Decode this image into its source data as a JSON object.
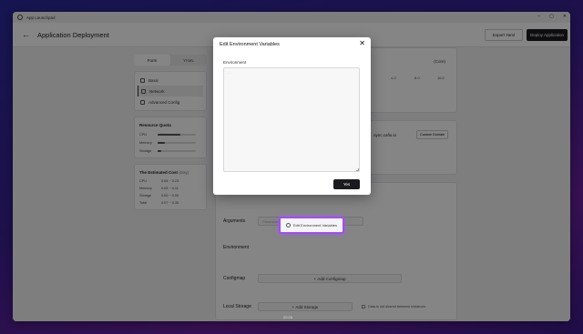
{
  "window": {
    "title": "App Launchpad",
    "controls": [
      "–",
      "▢",
      "✕"
    ]
  },
  "header": {
    "back_icon": "←",
    "title": "Application Deployment",
    "export_label": "Export Yaml",
    "deploy_label": "Deploy Application"
  },
  "sidebar": {
    "tabs": [
      "Form",
      "YAML"
    ],
    "nav": [
      {
        "label": "Basic"
      },
      {
        "label": "Network"
      },
      {
        "label": "Advanced Config"
      }
    ],
    "quota": {
      "title": "Resource Quota",
      "rows": [
        {
          "label": "CPU",
          "fill": 0.6
        },
        {
          "label": "Memory",
          "fill": 0.2
        },
        {
          "label": "Storage",
          "fill": 0.1
        }
      ]
    },
    "cost": {
      "title": "The Estimated Cost",
      "unit": "(Day)",
      "rows": [
        {
          "label": "CPU",
          "value": "0.04 ~ 0.23"
        },
        {
          "label": "Memory",
          "value": "0.03 ~ 0.11"
        },
        {
          "label": "Storage",
          "value": "0.00 ~ 0.00"
        },
        {
          "label": "Total",
          "value": "0.07 ~ 0.35"
        }
      ]
    }
  },
  "main": {
    "cpu_unit": "(Core)",
    "scale": [
      "4.0",
      "8.0",
      "16.0"
    ],
    "domain_suffix": ".sync.cafio.io",
    "custom_domain_label": "Custom Domain",
    "arguments": {
      "label": "Arguments",
      "placeholder": "Parameters, space to divide parameters"
    },
    "environment": {
      "label": "Environment",
      "button_label": "Edit Environment Variables"
    },
    "configmap": {
      "label": "Configmap",
      "button_label": "Add Configmap"
    },
    "local_storage": {
      "label": "Local Storage",
      "button_label": "Add Storage",
      "checkbox_label": "Data is not shared between instances"
    }
  },
  "modal": {
    "title": "Edit Environment Variables",
    "close_icon": "✕",
    "field_label": "Environment",
    "textarea_placeholder": "...",
    "confirm_label": "Yes"
  },
  "taskbar": {
    "time": "20:26"
  }
}
